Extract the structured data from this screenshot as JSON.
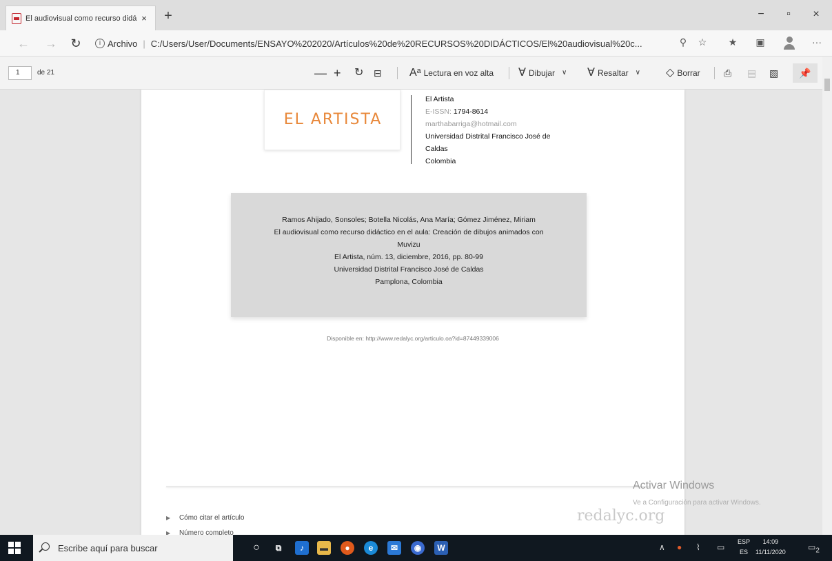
{
  "browser": {
    "tab_title": "El audiovisual como recurso didá",
    "tab_close": "×",
    "new_tab": "+",
    "window": {
      "minimize": "−",
      "maximize": "▫",
      "close": "×"
    }
  },
  "address": {
    "protocol_label": "Archivo",
    "url": "C:/Users/User/Documents/ENSAYO%202020/Artículos%20de%20RECURSOS%20DIDÁCTICOS/El%20audiovisual%20c..."
  },
  "pdf_toolbar": {
    "page_current": "1",
    "page_total": "de 21",
    "zoom_out": "—",
    "zoom_in": "+",
    "read_aloud": "Lectura en voz alta",
    "draw": "Dibujar",
    "highlight": "Resaltar",
    "erase": "Borrar"
  },
  "document": {
    "logo_text": "EL ARTISTA",
    "journal_name": "El Artista",
    "eissn_label": "E-ISSN:",
    "eissn_value": "1794-8614",
    "email": "marthabarriga@hotmail.com",
    "university_line1": "Universidad Distrital Francisco José de",
    "university_line2": "Caldas",
    "country": "Colombia",
    "citation": {
      "authors": "Ramos Ahijado, Sonsoles; Botella Nicolás, Ana María; Gómez Jiménez, Miriam",
      "title_line1": "El audiovisual como recurso didáctico en el aula: Creación de dibujos animados con",
      "title_line2": "Muvizu",
      "source": "El Artista, núm. 13, diciembre, 2016, pp. 80-99",
      "publisher": "Universidad Distrital Francisco José de Caldas",
      "location": "Pamplona, Colombia"
    },
    "available": "Disponible en: http://www.redalyc.org/articulo.oa?id=87449339006",
    "link_cite": "Cómo citar el artículo",
    "link_issue": "Número completo",
    "redalyc_logo": "redalyc.org"
  },
  "watermark": {
    "line1": "Activar Windows",
    "line2": "Ve a Configuración para activar Windows."
  },
  "taskbar": {
    "search_placeholder": "Escribe aquí para buscar",
    "lang_line1": "ESP",
    "lang_line2": "ES",
    "time": "14:09",
    "date": "11/11/2020",
    "notification_count": "2"
  }
}
